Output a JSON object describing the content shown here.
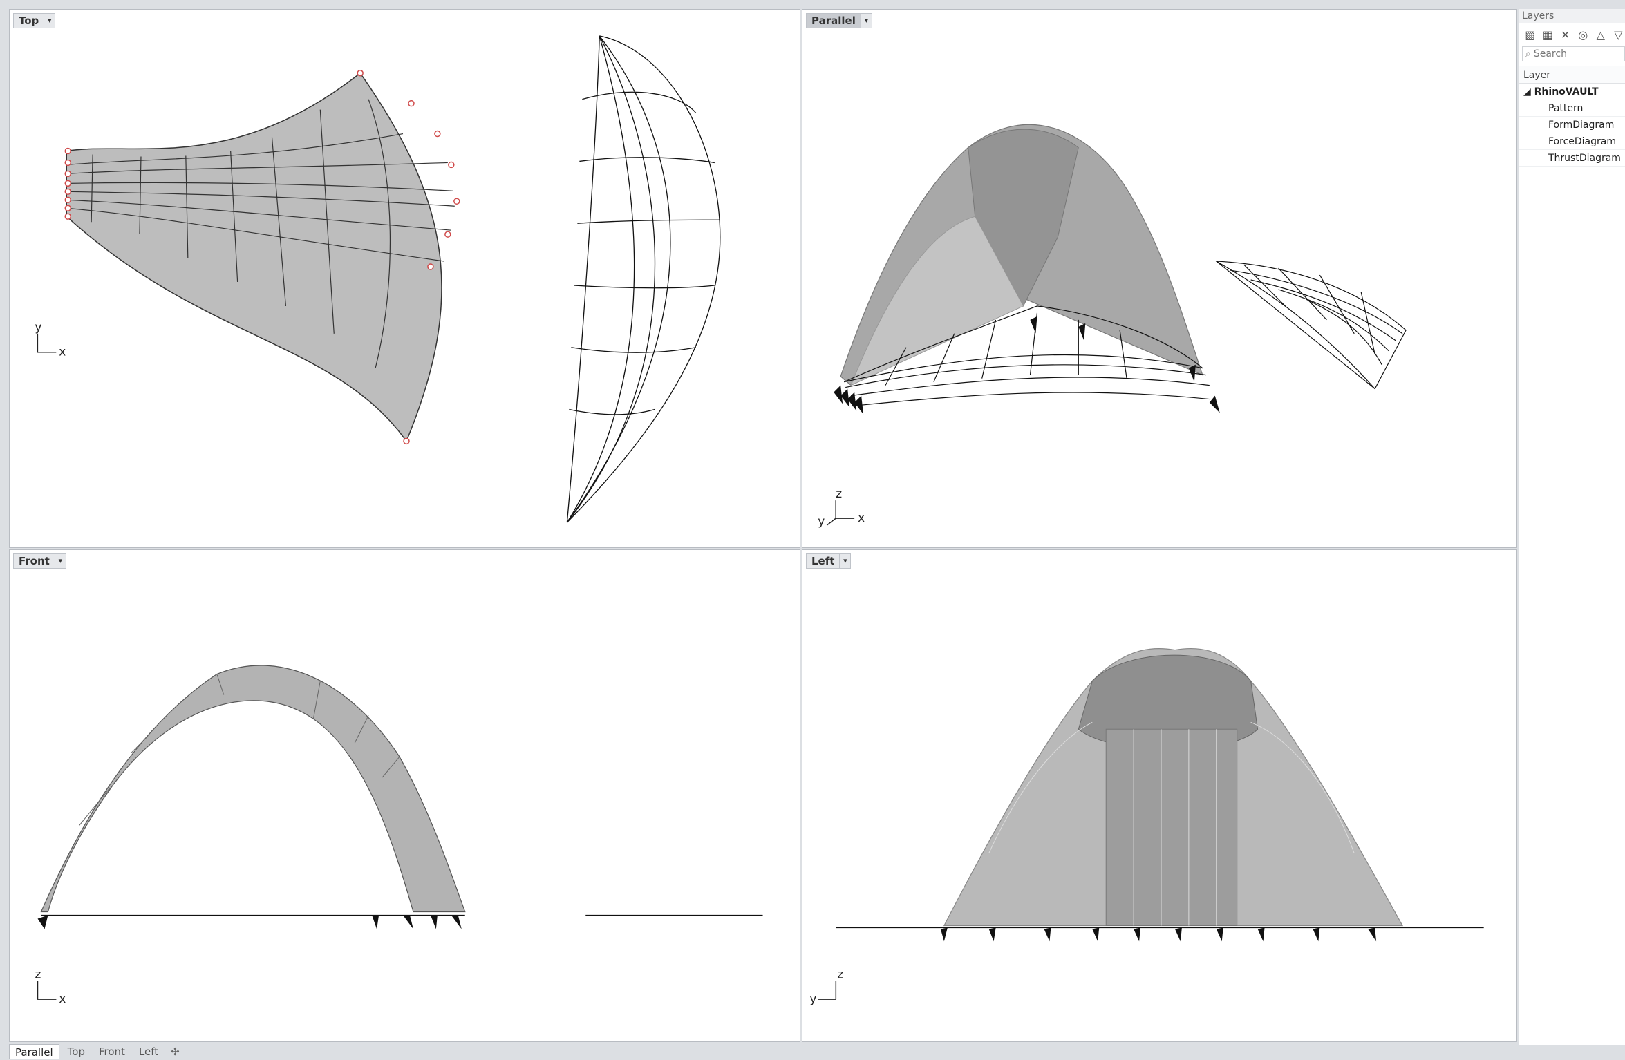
{
  "viewports": {
    "top": {
      "title": "Top",
      "axes": [
        "y",
        "x"
      ]
    },
    "parallel": {
      "title": "Parallel",
      "axes": [
        "z",
        "y",
        "x"
      ]
    },
    "front": {
      "title": "Front",
      "axes": [
        "z",
        "x"
      ]
    },
    "left": {
      "title": "Left",
      "axes": [
        "z",
        "y"
      ]
    },
    "dropdown_glyph": "▾"
  },
  "layers_panel": {
    "title": "Layers",
    "toolbar_icons": [
      "new-layer-icon",
      "new-sublayer-icon",
      "delete-icon",
      "filter-icon",
      "move-up-icon",
      "move-down-icon"
    ],
    "search_placeholder": "Search",
    "column_header": "Layer",
    "root": {
      "name": "RhinoVAULT",
      "expanded": true
    },
    "children": [
      "Pattern",
      "FormDiagram",
      "ForceDiagram",
      "ThrustDiagram"
    ]
  },
  "tabs": {
    "items": [
      "Parallel",
      "Top",
      "Front",
      "Left"
    ],
    "active": "Parallel",
    "add_glyph": "✣"
  },
  "colors": {
    "surface": "#b5b5b5",
    "surface_dark": "#8d8d8d",
    "edge": "#222222",
    "support": "#e06060",
    "background": "#ffffff",
    "chrome": "#dcdfe3"
  }
}
